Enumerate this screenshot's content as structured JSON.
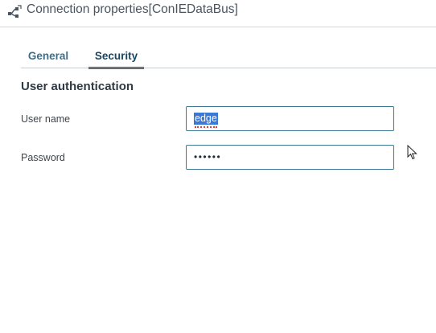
{
  "header": {
    "title": "Connection properties[ConIEDataBus]",
    "icon": "connection-icon"
  },
  "tabs": [
    {
      "label": "General",
      "active": false
    },
    {
      "label": "Security",
      "active": true
    }
  ],
  "section": {
    "title": "User authentication"
  },
  "fields": {
    "username": {
      "label": "User name",
      "value": "edge",
      "selected": true
    },
    "password": {
      "label": "Password",
      "masked_value": "••••••"
    }
  },
  "colors": {
    "accent": "#1b4660",
    "tab_inactive": "#3e6f8a",
    "input_border": "#3c7a94",
    "selection": "#3a79d6"
  }
}
